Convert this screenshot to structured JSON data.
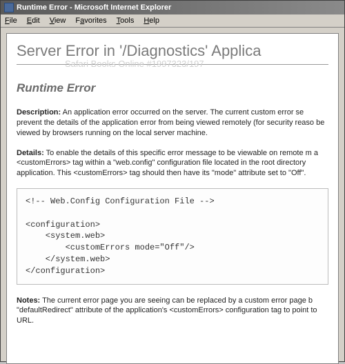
{
  "titlebar": {
    "title": "Runtime Error - Microsoft Internet Explorer"
  },
  "menubar": {
    "file": "File",
    "edit": "Edit",
    "view": "View",
    "favorites": "Favorites",
    "tools": "Tools",
    "help": "Help"
  },
  "page": {
    "h1": "Server Error in '/Diagnostics' Applica",
    "watermark": "Safari Books Online #1997323/197",
    "h2": "Runtime Error",
    "desc_label": "Description:",
    "desc_text": " An application error occurred on the server. The current custom error se prevent the details of the application error from being viewed remotely (for security reaso be viewed by browsers running on the local server machine.",
    "details_label": "Details:",
    "details_text": " To enable the details of this specific error message to be viewable on remote m a <customErrors> tag within a \"web.config\" configuration file located in the root directory application. This <customErrors> tag should then have its \"mode\" attribute set to \"Off\".",
    "code": "<!-- Web.Config Configuration File -->\n\n<configuration>\n    <system.web>\n        <customErrors mode=\"Off\"/>\n    </system.web>\n</configuration>",
    "notes_label": "Notes:",
    "notes_text": " The current error page you are seeing can be replaced by a custom error page b \"defaultRedirect\" attribute of the application's <customErrors> configuration tag to point to URL."
  }
}
